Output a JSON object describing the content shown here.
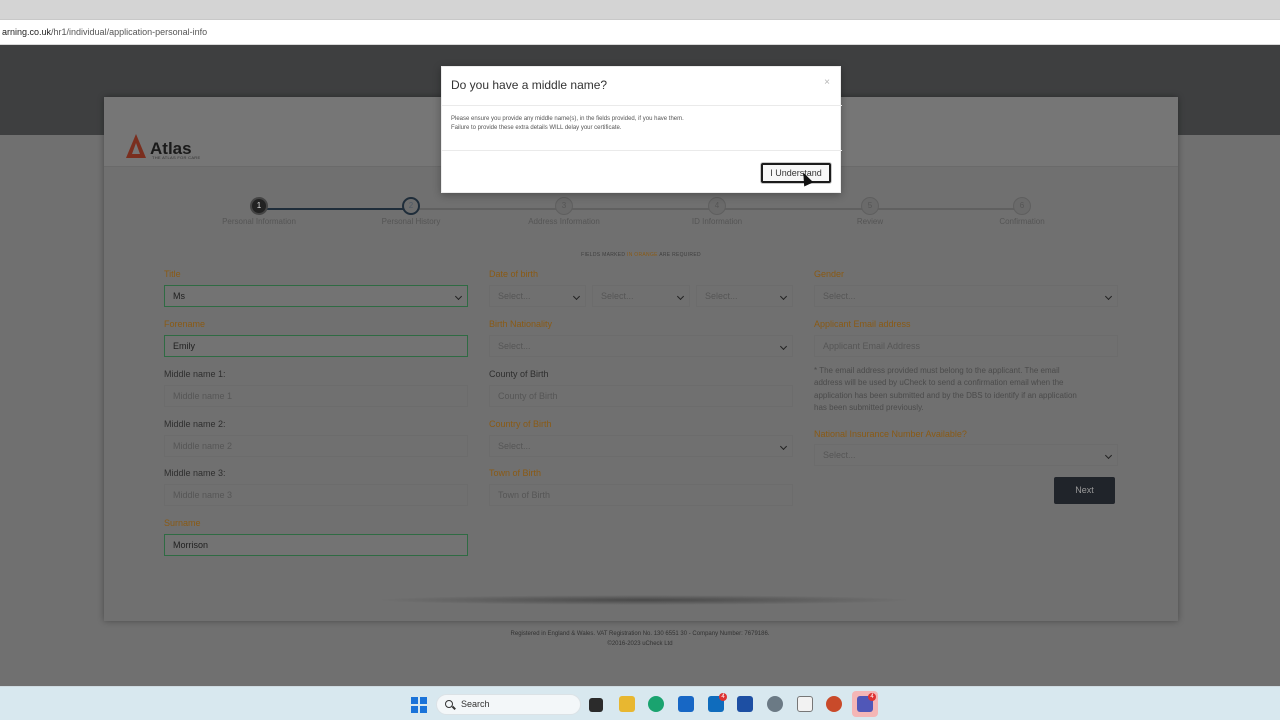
{
  "browser": {
    "url_host": "arning.co.uk",
    "url_path": "/hr1/individual/application-personal-info"
  },
  "brand": {
    "logo_text": "Atlas",
    "logo_sub": "THE ATLAS FOR CARE"
  },
  "stepper": {
    "steps": [
      {
        "num": "1",
        "label": "Personal Information"
      },
      {
        "num": "2",
        "label": "Personal History"
      },
      {
        "num": "3",
        "label": "Address Information"
      },
      {
        "num": "4",
        "label": "ID Information"
      },
      {
        "num": "5",
        "label": "Review"
      },
      {
        "num": "6",
        "label": "Confirmation"
      }
    ]
  },
  "required_note": {
    "prefix": "FIELDS MARKED",
    "highlight": "IN ORANGE",
    "suffix": "ARE REQUIRED"
  },
  "form": {
    "title": {
      "label": "Title",
      "value": "Ms"
    },
    "forename": {
      "label": "Forename",
      "value": "Emily"
    },
    "middle1": {
      "label": "Middle name 1:",
      "placeholder": "Middle name 1"
    },
    "middle2": {
      "label": "Middle name 2:",
      "placeholder": "Middle name 2"
    },
    "middle3": {
      "label": "Middle name 3:",
      "placeholder": "Middle name 3"
    },
    "surname": {
      "label": "Surname",
      "value": "Morrison"
    },
    "dob": {
      "label": "Date of birth",
      "day": "Select...",
      "month": "Select...",
      "year": "Select..."
    },
    "birth_nationality": {
      "label": "Birth Nationality",
      "value": "Select..."
    },
    "county_of_birth": {
      "label": "County of Birth",
      "placeholder": "County of Birth"
    },
    "country_of_birth": {
      "label": "Country of Birth",
      "value": "Select..."
    },
    "town_of_birth": {
      "label": "Town of Birth",
      "placeholder": "Town of Birth"
    },
    "gender": {
      "label": "Gender",
      "value": "Select..."
    },
    "email": {
      "label": "Applicant Email address",
      "placeholder": "Applicant Email Address"
    },
    "email_help": [
      "* The email address provided must belong to the applicant. The email",
      "address will be used by uCheck to send a confirmation email when the",
      "application has been submitted and by the DBS to identify if an application",
      "has been submitted previously."
    ],
    "ni_available": {
      "label": "National Insurance Number Available?",
      "value": "Select..."
    },
    "next_label": "Next"
  },
  "footer": {
    "line1": "Registered in England & Wales. VAT Registration No. 130 6551 30 - Company Number: 7679186.",
    "line2": "©2016-2023 uCheck Ltd"
  },
  "modal": {
    "title": "Do you have a middle name?",
    "close": "×",
    "body_line1": "Please ensure you provide any middle name(s), in the fields provided, if you have them.",
    "body_line2": "Failure to provide these extra details WILL delay your certificate.",
    "button": "I Understand"
  },
  "taskbar": {
    "search_label": "Search",
    "outlook_badge": "4",
    "teams_badge": "4"
  },
  "colors": {
    "accent_orange": "#8a5a14",
    "filled_border": "#2f6b43",
    "windows_blue": "#1a73d9"
  }
}
